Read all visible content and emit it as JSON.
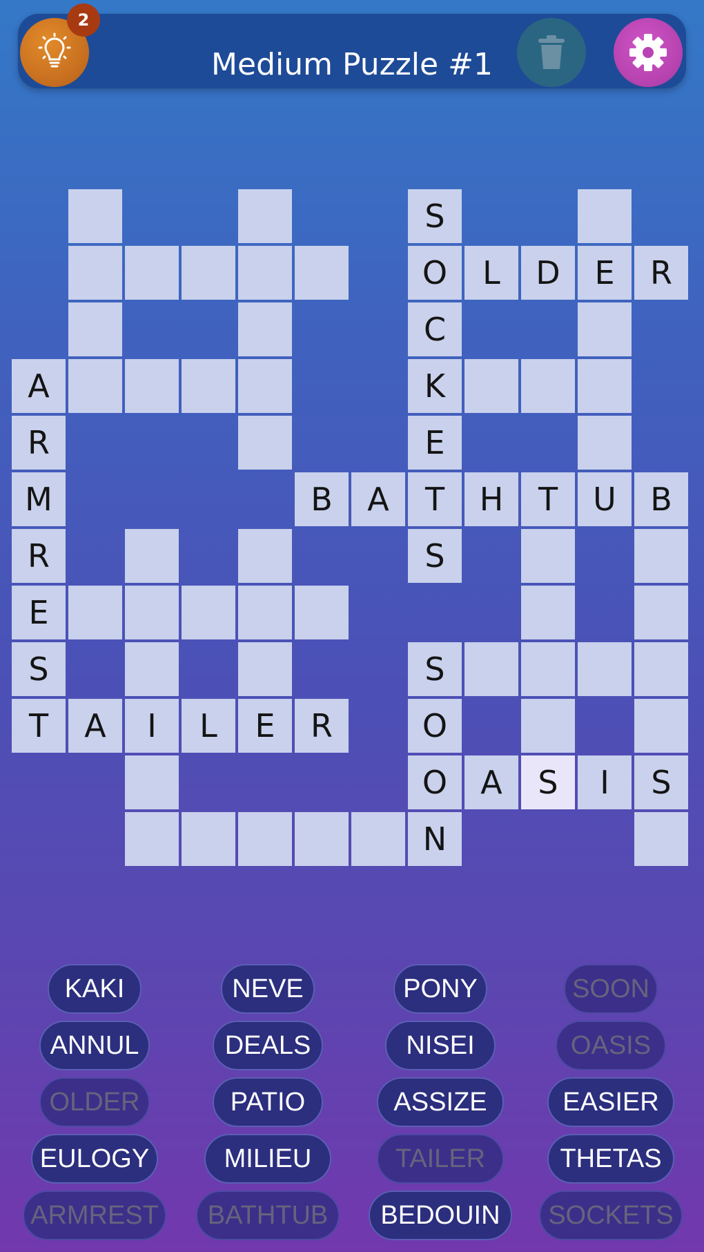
{
  "header": {
    "title": "Medium Puzzle #1",
    "hint_count": "2",
    "hint_icon": "lightbulb-icon",
    "trash_icon": "trash-icon",
    "settings_icon": "gear-icon"
  },
  "colors": {
    "cell": "#c9d1ec",
    "cell_highlight": "#eae6fa",
    "pill": "#2c2e7e",
    "pill_used_text": "#67637d",
    "hint_button": "#c8711f",
    "settings_button": "#c04ab9",
    "trash_button": "#2a6681"
  },
  "grid": {
    "cols": 12,
    "rows": 12,
    "cells": [
      {
        "r": 0,
        "c": 1,
        "letter": ""
      },
      {
        "r": 0,
        "c": 4,
        "letter": ""
      },
      {
        "r": 0,
        "c": 7,
        "letter": "S"
      },
      {
        "r": 0,
        "c": 10,
        "letter": ""
      },
      {
        "r": 1,
        "c": 1,
        "letter": ""
      },
      {
        "r": 1,
        "c": 2,
        "letter": ""
      },
      {
        "r": 1,
        "c": 3,
        "letter": ""
      },
      {
        "r": 1,
        "c": 4,
        "letter": ""
      },
      {
        "r": 1,
        "c": 5,
        "letter": ""
      },
      {
        "r": 1,
        "c": 7,
        "letter": "O"
      },
      {
        "r": 1,
        "c": 8,
        "letter": "L"
      },
      {
        "r": 1,
        "c": 9,
        "letter": "D"
      },
      {
        "r": 1,
        "c": 10,
        "letter": "E"
      },
      {
        "r": 1,
        "c": 11,
        "letter": "R"
      },
      {
        "r": 2,
        "c": 1,
        "letter": ""
      },
      {
        "r": 2,
        "c": 4,
        "letter": ""
      },
      {
        "r": 2,
        "c": 7,
        "letter": "C"
      },
      {
        "r": 2,
        "c": 10,
        "letter": ""
      },
      {
        "r": 3,
        "c": 0,
        "letter": "A"
      },
      {
        "r": 3,
        "c": 1,
        "letter": ""
      },
      {
        "r": 3,
        "c": 2,
        "letter": ""
      },
      {
        "r": 3,
        "c": 3,
        "letter": ""
      },
      {
        "r": 3,
        "c": 4,
        "letter": ""
      },
      {
        "r": 3,
        "c": 7,
        "letter": "K"
      },
      {
        "r": 3,
        "c": 8,
        "letter": ""
      },
      {
        "r": 3,
        "c": 9,
        "letter": ""
      },
      {
        "r": 3,
        "c": 10,
        "letter": ""
      },
      {
        "r": 4,
        "c": 0,
        "letter": "R"
      },
      {
        "r": 4,
        "c": 4,
        "letter": ""
      },
      {
        "r": 4,
        "c": 7,
        "letter": "E"
      },
      {
        "r": 4,
        "c": 10,
        "letter": ""
      },
      {
        "r": 5,
        "c": 0,
        "letter": "M"
      },
      {
        "r": 5,
        "c": 5,
        "letter": "B"
      },
      {
        "r": 5,
        "c": 6,
        "letter": "A"
      },
      {
        "r": 5,
        "c": 7,
        "letter": "T"
      },
      {
        "r": 5,
        "c": 8,
        "letter": "H"
      },
      {
        "r": 5,
        "c": 9,
        "letter": "T"
      },
      {
        "r": 5,
        "c": 10,
        "letter": "U"
      },
      {
        "r": 5,
        "c": 11,
        "letter": "B"
      },
      {
        "r": 6,
        "c": 0,
        "letter": "R"
      },
      {
        "r": 6,
        "c": 2,
        "letter": ""
      },
      {
        "r": 6,
        "c": 4,
        "letter": ""
      },
      {
        "r": 6,
        "c": 7,
        "letter": "S"
      },
      {
        "r": 6,
        "c": 9,
        "letter": ""
      },
      {
        "r": 6,
        "c": 11,
        "letter": ""
      },
      {
        "r": 7,
        "c": 0,
        "letter": "E"
      },
      {
        "r": 7,
        "c": 1,
        "letter": ""
      },
      {
        "r": 7,
        "c": 2,
        "letter": ""
      },
      {
        "r": 7,
        "c": 3,
        "letter": ""
      },
      {
        "r": 7,
        "c": 4,
        "letter": ""
      },
      {
        "r": 7,
        "c": 5,
        "letter": ""
      },
      {
        "r": 7,
        "c": 9,
        "letter": ""
      },
      {
        "r": 7,
        "c": 11,
        "letter": ""
      },
      {
        "r": 8,
        "c": 0,
        "letter": "S"
      },
      {
        "r": 8,
        "c": 2,
        "letter": ""
      },
      {
        "r": 8,
        "c": 4,
        "letter": ""
      },
      {
        "r": 8,
        "c": 7,
        "letter": "S"
      },
      {
        "r": 8,
        "c": 8,
        "letter": ""
      },
      {
        "r": 8,
        "c": 9,
        "letter": ""
      },
      {
        "r": 8,
        "c": 10,
        "letter": ""
      },
      {
        "r": 8,
        "c": 11,
        "letter": ""
      },
      {
        "r": 9,
        "c": 0,
        "letter": "T"
      },
      {
        "r": 9,
        "c": 1,
        "letter": "A"
      },
      {
        "r": 9,
        "c": 2,
        "letter": "I"
      },
      {
        "r": 9,
        "c": 3,
        "letter": "L"
      },
      {
        "r": 9,
        "c": 4,
        "letter": "E"
      },
      {
        "r": 9,
        "c": 5,
        "letter": "R"
      },
      {
        "r": 9,
        "c": 7,
        "letter": "O"
      },
      {
        "r": 9,
        "c": 9,
        "letter": ""
      },
      {
        "r": 9,
        "c": 11,
        "letter": ""
      },
      {
        "r": 10,
        "c": 2,
        "letter": ""
      },
      {
        "r": 10,
        "c": 7,
        "letter": "O"
      },
      {
        "r": 10,
        "c": 8,
        "letter": "A"
      },
      {
        "r": 10,
        "c": 9,
        "letter": "S",
        "highlight": true
      },
      {
        "r": 10,
        "c": 10,
        "letter": "I"
      },
      {
        "r": 10,
        "c": 11,
        "letter": "S"
      },
      {
        "r": 11,
        "c": 2,
        "letter": ""
      },
      {
        "r": 11,
        "c": 3,
        "letter": ""
      },
      {
        "r": 11,
        "c": 4,
        "letter": ""
      },
      {
        "r": 11,
        "c": 5,
        "letter": ""
      },
      {
        "r": 11,
        "c": 6,
        "letter": ""
      },
      {
        "r": 11,
        "c": 7,
        "letter": "N"
      },
      {
        "r": 11,
        "c": 11,
        "letter": ""
      }
    ]
  },
  "word_bank": {
    "columns": 4,
    "rows": [
      [
        {
          "text": "KAKI",
          "used": false
        },
        {
          "text": "NEVE",
          "used": false
        },
        {
          "text": "PONY",
          "used": false
        },
        {
          "text": "SOON",
          "used": true
        }
      ],
      [
        {
          "text": "ANNUL",
          "used": false
        },
        {
          "text": "DEALS",
          "used": false
        },
        {
          "text": "NISEI",
          "used": false
        },
        {
          "text": "OASIS",
          "used": true
        }
      ],
      [
        {
          "text": "OLDER",
          "used": true
        },
        {
          "text": "PATIO",
          "used": false
        },
        {
          "text": "ASSIZE",
          "used": false
        },
        {
          "text": "EASIER",
          "used": false
        }
      ],
      [
        {
          "text": "EULOGY",
          "used": false
        },
        {
          "text": "MILIEU",
          "used": false
        },
        {
          "text": "TAILER",
          "used": true
        },
        {
          "text": "THETAS",
          "used": false
        }
      ],
      [
        {
          "text": "ARMREST",
          "used": true
        },
        {
          "text": "BATHTUB",
          "used": true
        },
        {
          "text": "BEDOUIN",
          "used": false
        },
        {
          "text": "SOCKETS",
          "used": true
        }
      ]
    ]
  }
}
